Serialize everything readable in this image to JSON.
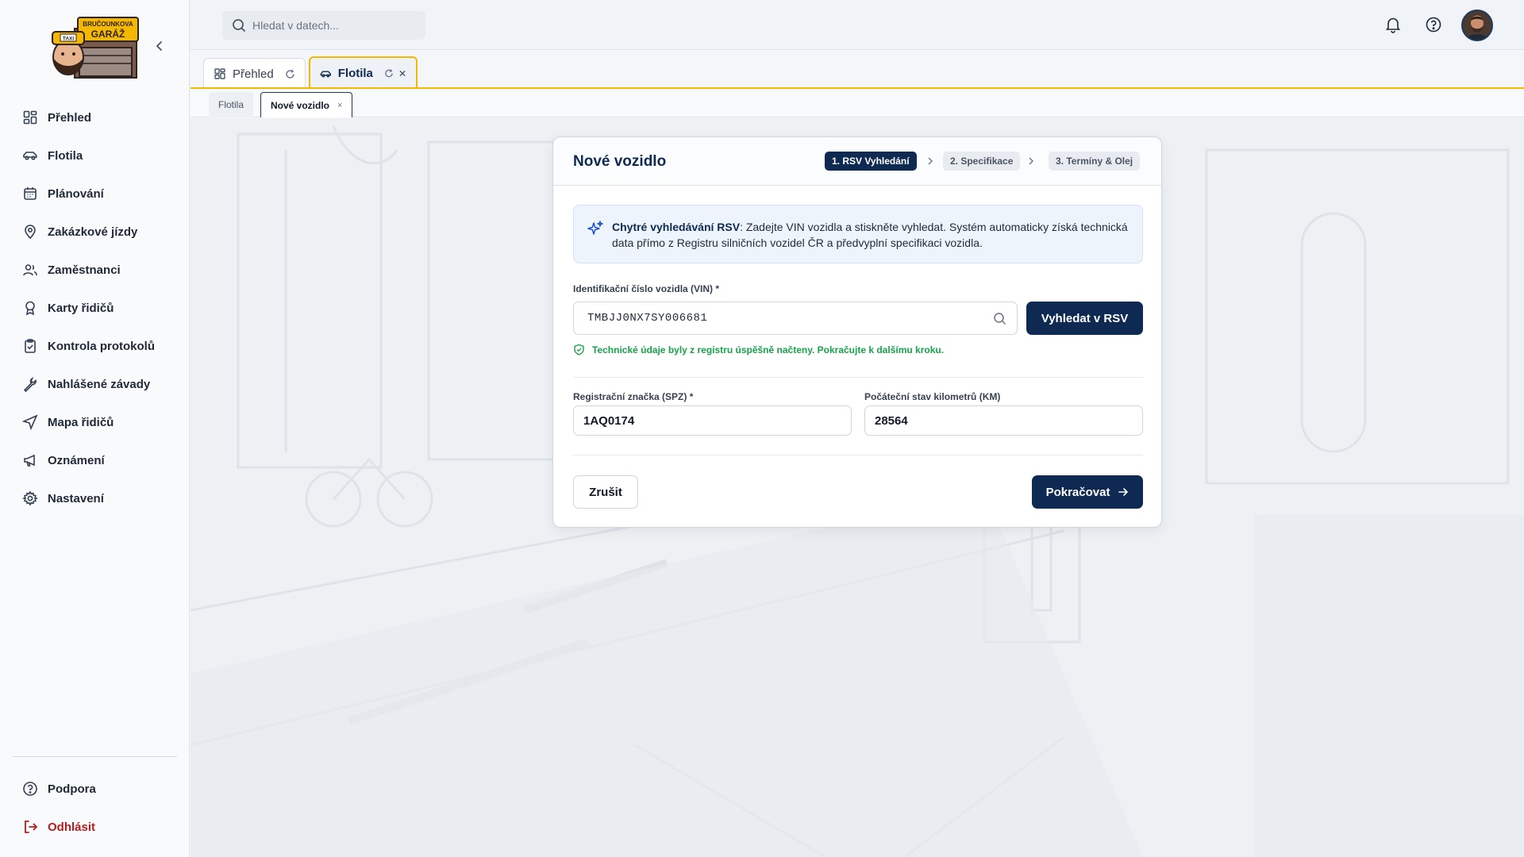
{
  "brand": {
    "logo_line1": "BRUČOUNKOVA",
    "logo_line2": "GARÁŽ",
    "logo_sign": "TAXI"
  },
  "sidebar": {
    "items": [
      {
        "label": "Přehled",
        "icon": "dashboard-icon"
      },
      {
        "label": "Flotila",
        "icon": "car-icon"
      },
      {
        "label": "Plánování",
        "icon": "calendar-icon"
      },
      {
        "label": "Zakázkové jízdy",
        "icon": "map-pin-icon"
      },
      {
        "label": "Zaměstnanci",
        "icon": "users-icon"
      },
      {
        "label": "Karty řidičů",
        "icon": "badge-icon"
      },
      {
        "label": "Kontrola protokolů",
        "icon": "clipboard-check-icon"
      },
      {
        "label": "Nahlášené závady",
        "icon": "wrench-icon"
      },
      {
        "label": "Mapa řidičů",
        "icon": "navigation-icon"
      },
      {
        "label": "Oznámení",
        "icon": "megaphone-icon"
      },
      {
        "label": "Nastavení",
        "icon": "gear-icon"
      }
    ],
    "support": "Podpora",
    "logout": "Odhlásit"
  },
  "topbar": {
    "search_placeholder": "Hledat v datech..."
  },
  "tabs": [
    {
      "label": "Přehled",
      "active": false
    },
    {
      "label": "Flotila",
      "active": true
    }
  ],
  "subtabs": [
    {
      "label": "Flotila",
      "active": false
    },
    {
      "label": "Nové vozidlo",
      "active": true,
      "close": "×"
    }
  ],
  "card": {
    "title": "Nové vozidlo",
    "steps": [
      "1. RSV Vyhledání",
      "2. Specifikace",
      "3. Termíny & Olej"
    ],
    "active_step": 1,
    "info_title": "Chytré vyhledávání RSV",
    "info_text": ": Zadejte VIN vozidla a stiskněte vyhledat. Systém automaticky získá technická data přímo z Registru silničních vozidel ČR a předvyplní specifikaci vozidla.",
    "vin_label": "Identifikační číslo vozidla (VIN) *",
    "vin_value": "TMBJJ0NX7SY006681",
    "search_button": "Vyhledat v RSV",
    "success_text": "Technické údaje byly z registru úspěšně načteny. Pokračujte k dalšímu kroku.",
    "spz_label": "Registrační značka (SPZ) *",
    "spz_value": "1AQ0174",
    "km_label": "Počáteční stav kilometrů (KM)",
    "km_value": "28564",
    "cancel_button": "Zrušit",
    "continue_button": "Pokračovat"
  },
  "colors": {
    "primary": "#0f2a52",
    "accent": "#f5b800",
    "success": "#16a34a",
    "danger": "#b91c1c"
  }
}
